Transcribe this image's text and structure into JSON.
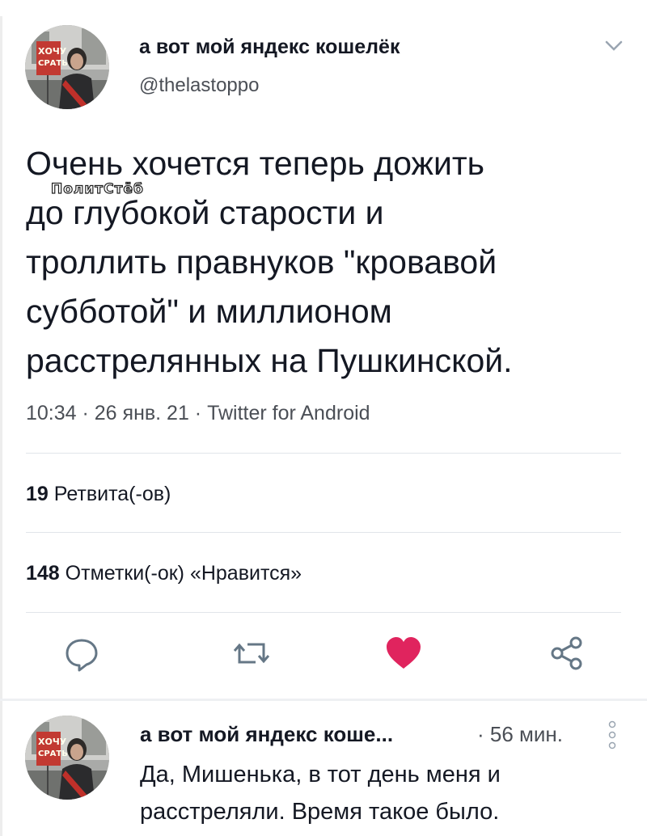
{
  "tweet": {
    "author_name": "а вот мой яндекс кошелёк",
    "author_handle": "@thelastoppo",
    "text_lines": [
      "Очень хочется теперь дожить",
      "до глубокой старости и",
      "троллить правнуков \"кровавой",
      "субботой\" и миллионом",
      "расстрелянных на Пушкинской."
    ],
    "meta": "10:34 · 26 янв. 21 · Twitter for Android",
    "retweets_count": "19",
    "retweets_label": "Ретвита(-ов)",
    "likes_count": "148",
    "likes_label": "Отметки(-ок) «Нравится»",
    "avatar_sign_text": "ХОЧУ\nСРАТЬ"
  },
  "watermark": "ПолитСтёб",
  "reply": {
    "author_name": "а вот мой яндекс коше...",
    "time": "· 56 мин.",
    "text_lines": [
      "Да, Мишенька, в тот день меня и",
      "расстреляли. Время такое было."
    ]
  },
  "icons": {
    "caret": "chevron-down-icon",
    "reply": "reply-icon",
    "retweet": "retweet-icon",
    "like": "heart-icon",
    "share": "share-icon",
    "more": "more-vertical-icon"
  },
  "colors": {
    "like_red": "#e0245e",
    "icon_gray": "#657786",
    "text": "#141823",
    "secondary": "#4b4f56"
  }
}
